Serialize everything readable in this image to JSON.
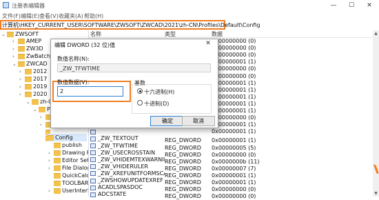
{
  "window": {
    "title": "注册表编辑器",
    "minimize_glyph": "—",
    "maximize_glyph": "☐",
    "close_glyph": "✕"
  },
  "menu": [
    "文件(F)",
    "编辑(E)",
    "查看(V)",
    "收藏夹(A)",
    "帮助(H)"
  ],
  "address": {
    "path": "计算机\\HKEY_CURRENT_USER\\SOFTWARE\\ZWSOFT\\ZWCAD\\2021\\zh-CN\\Profiles\\Default\\Config"
  },
  "tree": [
    {
      "label": "ZWSOFT",
      "chev": "⌄"
    },
    {
      "label": "AMEP",
      "chev": "›"
    },
    {
      "label": "ZW3D",
      "chev": "›"
    },
    {
      "label": "ZwBatchPlot",
      "chev": "›"
    },
    {
      "label": "ZWCAD",
      "chev": "⌄"
    },
    {
      "label": "2012",
      "chev": "›"
    },
    {
      "label": "2017",
      "chev": "›"
    },
    {
      "label": "2019",
      "chev": "›"
    },
    {
      "label": "2020",
      "chev": "›"
    },
    {
      "label": "zh-CN",
      "chev": "⌄"
    },
    {
      "label": "Pro",
      "chev": "⌄"
    },
    {
      "label": "",
      "chev": "›"
    },
    {
      "label": "",
      "chev": "›"
    },
    {
      "label": "",
      "chev": ""
    },
    {
      "label": "",
      "chev": ""
    },
    {
      "label": "Config",
      "chev": ""
    },
    {
      "label": "publish",
      "chev": ""
    },
    {
      "label": "Drawing R",
      "chev": "›"
    },
    {
      "label": "Editor Sett",
      "chev": "›"
    },
    {
      "label": "File Dialog",
      "chev": "›"
    },
    {
      "label": "QuickCalc",
      "chev": ""
    },
    {
      "label": "TOOLBAR",
      "chev": ""
    },
    {
      "label": "UserInterfa",
      "chev": "›"
    }
  ],
  "list": {
    "headers": {
      "name": "名称",
      "type": "类型",
      "data": "数据"
    },
    "rows": [
      {
        "name": "",
        "type": "REG_DWORD",
        "data": "0x00000000 (0)"
      },
      {
        "name": "",
        "type": "REG_DWORD",
        "data": "0x00000000 (0)"
      },
      {
        "name": "",
        "type": "",
        "data": "0x00000000 (0)"
      },
      {
        "name": "",
        "type": "",
        "data": "0x00000001 (1)"
      },
      {
        "name": "",
        "type": "",
        "data": "0x00000000 (0)"
      },
      {
        "name": "",
        "type": "",
        "data": "0x00000000 (0)"
      },
      {
        "name": "",
        "type": "",
        "data": "0x00000001 (1)"
      },
      {
        "name": "",
        "type": "",
        "data": "0x00000001 (1)"
      },
      {
        "name": "",
        "type": "",
        "data": "0x00000001 (1)"
      },
      {
        "name": "",
        "type": "",
        "data": "0x00000001 (1)"
      },
      {
        "name": "",
        "type": "",
        "data": "0x00000001 (1)"
      },
      {
        "name": "",
        "type": "",
        "data": "0x00000000 (0)"
      },
      {
        "name": "",
        "type": "",
        "data": "0x00000001 (1)"
      },
      {
        "name": "",
        "type": "",
        "data": "0x00000001 (1)"
      },
      {
        "name": "_ZW_TEXTOUT",
        "type": "REG_DWORD",
        "data": "0x00000001 (1)"
      },
      {
        "name": "_ZW_TFWTIME",
        "type": "REG_DWORD",
        "data": "0x00000005 (5)"
      },
      {
        "name": "_ZW_USECROSSTAIN",
        "type": "REG_DWORD",
        "data": "0x00000000 (0)"
      },
      {
        "name": "_ZW_VHIDEMTEXWARNING",
        "type": "REG_DWORD",
        "data": "0x0000000b (11)"
      },
      {
        "name": "_ZW_VHIDERULER",
        "type": "REG_DWORD",
        "data": "0x00000007 (7)"
      },
      {
        "name": "_ZW_XREFUNITFORMSCALE",
        "type": "REG_DWORD",
        "data": "0x00000001 (1)"
      },
      {
        "name": "_ZWSHOWUPDATEXREF",
        "type": "REG_DWORD",
        "data": "0x00000001 (1)"
      },
      {
        "name": "ACADLSPASDOC",
        "type": "REG_DWORD",
        "data": "0x00000000 (0)"
      },
      {
        "name": "ADCSTATE",
        "type": "REG_DWORD",
        "data": "0x00000000 (0)"
      }
    ]
  },
  "dialog": {
    "title": "编辑 DWORD (32 位)值",
    "close_glyph": "✕",
    "name_label": "数值名称(N):",
    "name_value": "_ZW_TFWTIME",
    "data_label": "数值数据(V):",
    "data_value": "2",
    "base_label": "基数",
    "hex_label": "十六进制(H)",
    "dec_label": "十进制(D)",
    "ok_label": "确定",
    "cancel_label": "取消"
  },
  "colors": {
    "highlight": "#ef7d22",
    "focus": "#2a7fd4"
  }
}
